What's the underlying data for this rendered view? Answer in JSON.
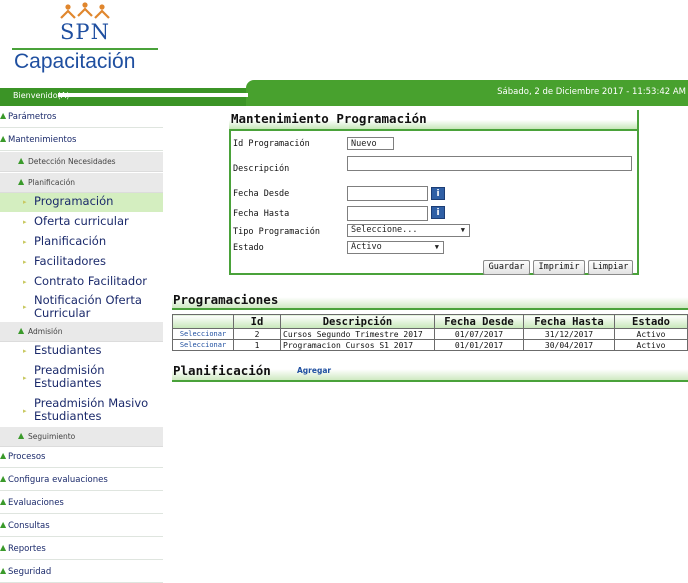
{
  "logo": {
    "brand": "SPN",
    "app_title": "Capacitación"
  },
  "header": {
    "welcome": "Bienvenido(A)",
    "datetime": "Sábado, 2 de Diciembre 2017 - 11:53:42 AM",
    "accent": "#48a12e"
  },
  "sidebar": {
    "parametros": "Parámetros",
    "mantenimientos": "Mantenimientos",
    "deteccion": "Detección Necesidades",
    "planificacion_group": "Planificación",
    "programacion": "Programación",
    "oferta": "Oferta curricular",
    "planificacion": "Planificación",
    "facilitadores": "Facilitadores",
    "contrato": "Contrato Facilitador",
    "notificacion_1": "Notificación Oferta",
    "notificacion_2": "Curricular",
    "admision": "Admisión",
    "estudiantes": "Estudiantes",
    "preadmision_1": "Preadmisión",
    "preadmision_2": "Estudiantes",
    "preadmision_masivo_1": "Preadmisión Masivo",
    "preadmision_masivo_2": "Estudiantes",
    "seguimiento": "Seguimiento",
    "procesos": "Procesos",
    "configura": "Configura evaluaciones",
    "evaluaciones": "Evaluaciones",
    "consultas": "Consultas",
    "reportes": "Reportes",
    "seguridad": "Seguridad"
  },
  "form": {
    "title": "Mantenimiento Programación",
    "id_label": "Id Programación",
    "id_value": "Nuevo",
    "descripcion_label": "Descripción",
    "fecha_desde_label": "Fecha Desde",
    "fecha_hasta_label": "Fecha Hasta",
    "tipo_label": "Tipo Programación",
    "tipo_value": "Seleccione...",
    "estado_label": "Estado",
    "estado_value": "Activo",
    "calendar_glyph": "i",
    "guardar": "Guardar",
    "imprimir": "Imprimir",
    "limpiar": "Limpiar"
  },
  "programaciones": {
    "title": "Programaciones",
    "columns": [
      "",
      "Id",
      "Descripción",
      "Fecha Desde",
      "Fecha Hasta",
      "Estado"
    ],
    "rows": [
      {
        "action": "Seleccionar",
        "id": "2",
        "descripcion": "Cursos Segundo Trimestre 2017",
        "desde": "01/07/2017",
        "hasta": "31/12/2017",
        "estado": "Activo"
      },
      {
        "action": "Seleccionar",
        "id": "1",
        "descripcion": "Programacion Cursos S1 2017",
        "desde": "01/01/2017",
        "hasta": "30/04/2017",
        "estado": "Activo"
      }
    ]
  },
  "planificacion": {
    "title": "Planificación",
    "agregar": "Agregar"
  }
}
